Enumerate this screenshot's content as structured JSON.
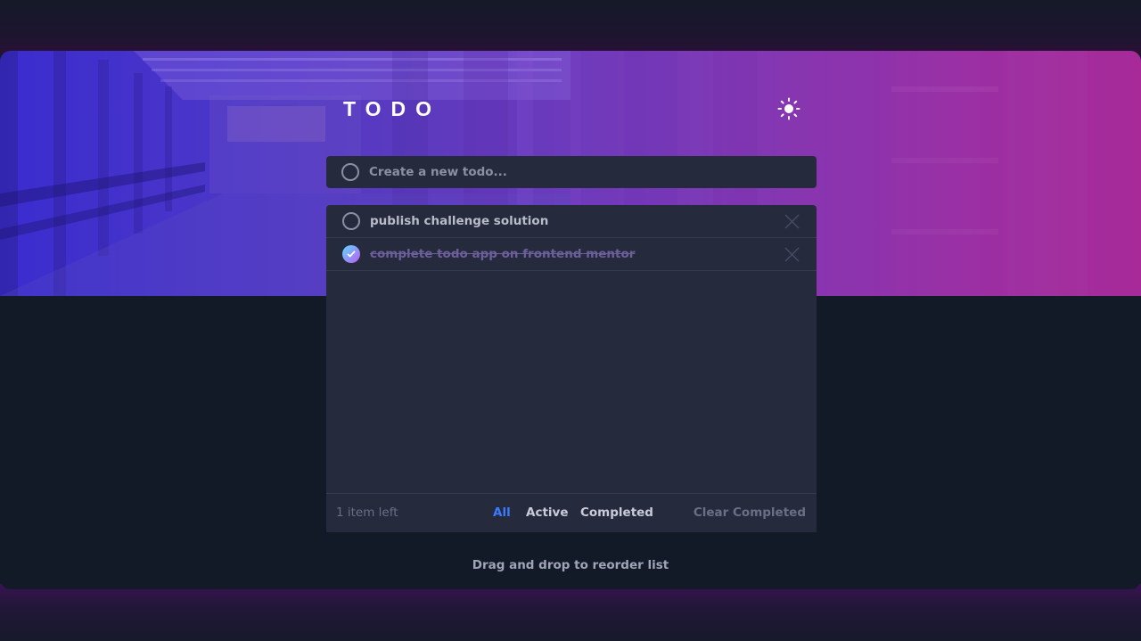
{
  "header": {
    "title": "TODO",
    "theme_toggle_icon": "sun-icon"
  },
  "new_todo": {
    "placeholder": "Create a new todo..."
  },
  "todos": [
    {
      "text": "publish challenge solution",
      "completed": false
    },
    {
      "text": "complete todo app on frontend mentor",
      "completed": true
    }
  ],
  "footer": {
    "items_left": "1 item left",
    "filter_all": "All",
    "filter_active": "Active",
    "filter_completed": "Completed",
    "clear_completed": "Clear Completed",
    "active_filter": "All"
  },
  "hint": "Drag and drop to reorder list",
  "colors": {
    "accent": "#3a7bfd",
    "card": "#252a3d",
    "background": "#141a28",
    "check_gradient_start": "#57ddff",
    "check_gradient_end": "#c058f3"
  }
}
